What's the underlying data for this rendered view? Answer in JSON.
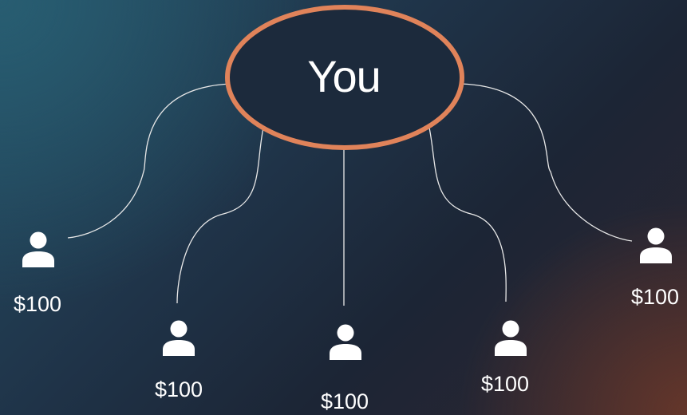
{
  "center": {
    "label": "You"
  },
  "people": [
    {
      "icon": "person-icon",
      "amount": "$100"
    },
    {
      "icon": "person-icon",
      "amount": "$100"
    },
    {
      "icon": "person-icon",
      "amount": "$100"
    },
    {
      "icon": "person-icon",
      "amount": "$100"
    },
    {
      "icon": "person-icon",
      "amount": "$100"
    }
  ],
  "colors": {
    "ellipse_stroke": "#e0835a",
    "lines": "#e8e8e8",
    "text": "#ffffff"
  }
}
